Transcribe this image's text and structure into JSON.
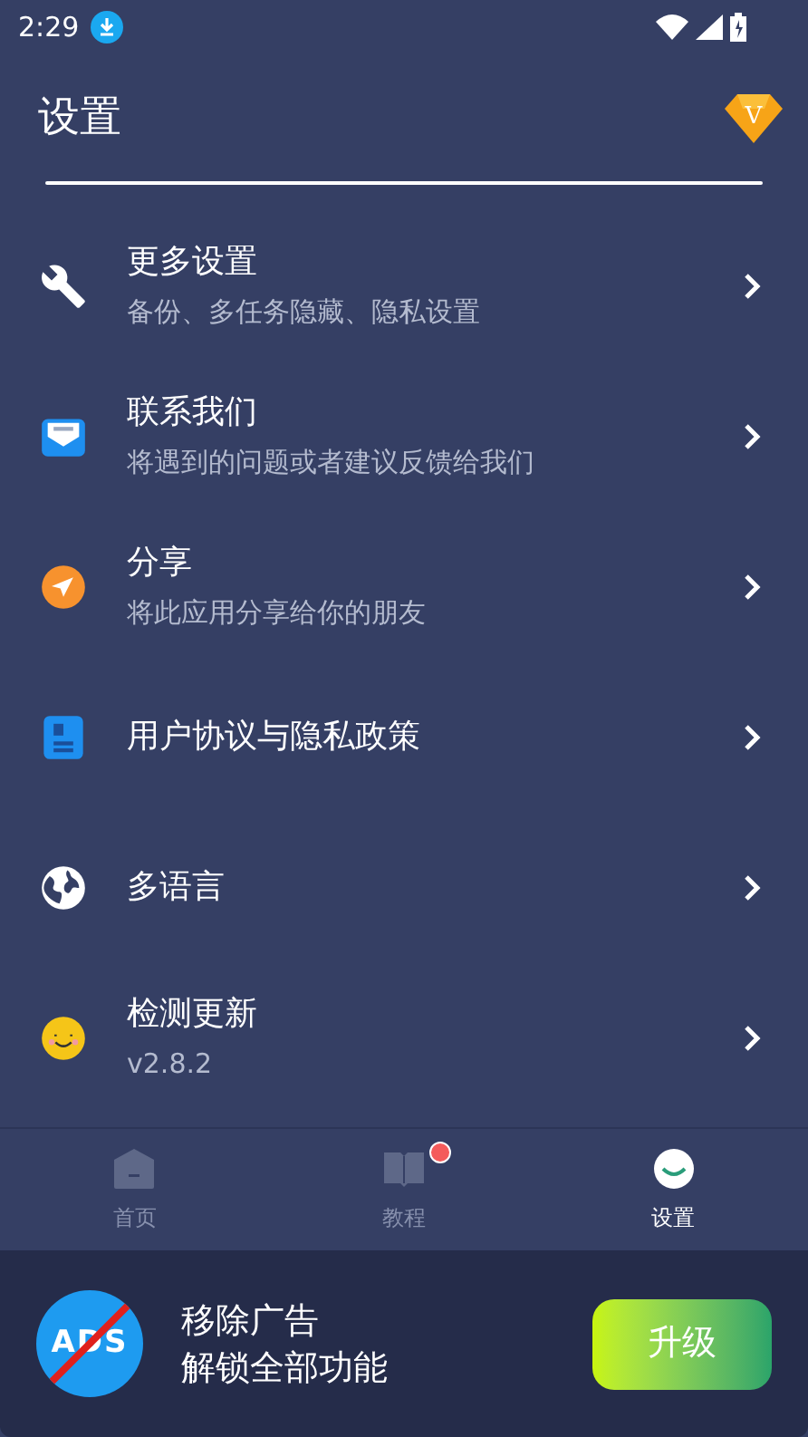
{
  "status_bar": {
    "time": "2:29"
  },
  "header": {
    "title": "设置",
    "vip_badge": "V"
  },
  "items": [
    {
      "kind": "wrench",
      "title": "更多设置",
      "subtitle": "备份、多任务隐藏、隐私设置"
    },
    {
      "kind": "mail",
      "title": "联系我们",
      "subtitle": "将遇到的问题或者建议反馈给我们"
    },
    {
      "kind": "send",
      "title": "分享",
      "subtitle": "将此应用分享给你的朋友"
    },
    {
      "kind": "document",
      "title": "用户协议与隐私政策"
    },
    {
      "kind": "globe",
      "title": "多语言"
    },
    {
      "kind": "smiley",
      "title": "检测更新",
      "subtitle": "v2.8.2"
    }
  ],
  "bottom_nav": [
    {
      "kind": "home",
      "label": "首页",
      "selected": false,
      "badge": false
    },
    {
      "kind": "book",
      "label": "教程",
      "selected": false,
      "badge": true
    },
    {
      "kind": "smile",
      "label": "设置",
      "selected": true,
      "badge": false
    }
  ],
  "promo": {
    "logo_text": "ADS",
    "line_1": "移除广告",
    "line_2": "解锁全部功能",
    "button": "升级"
  }
}
